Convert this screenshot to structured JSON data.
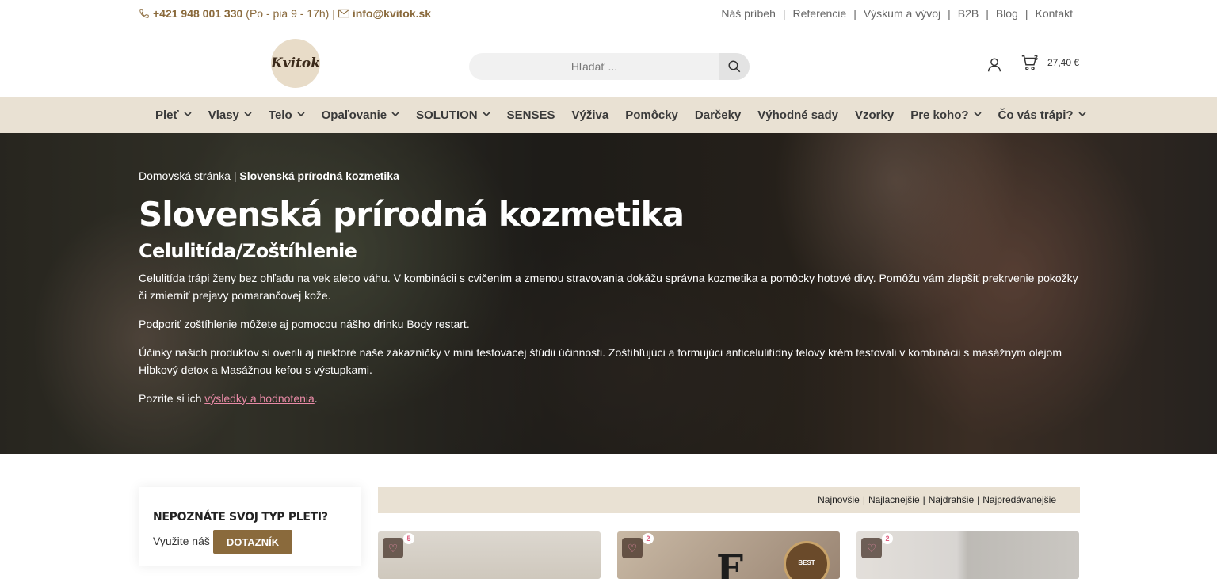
{
  "topbar": {
    "phone": "+421 948 001 330",
    "hours": "(Po - pia 9 - 17h) |",
    "email": "info@kvitok.sk",
    "links": [
      "Náš príbeh",
      "Referencie",
      "Výskum a vývoj",
      "B2B",
      "Blog",
      "Kontakt"
    ]
  },
  "header": {
    "logo_text": "Kvitok",
    "search_placeholder": "Hľadať ...",
    "cart_count": "3",
    "cart_total": "27,40 €"
  },
  "nav": {
    "items": [
      {
        "label": "Pleť",
        "dropdown": true
      },
      {
        "label": "Vlasy",
        "dropdown": true
      },
      {
        "label": "Telo",
        "dropdown": true
      },
      {
        "label": "Opaľovanie",
        "dropdown": true
      },
      {
        "label": "SOLUTION",
        "dropdown": true
      },
      {
        "label": "SENSES",
        "dropdown": false
      },
      {
        "label": "Výživa",
        "dropdown": false
      },
      {
        "label": "Pomôcky",
        "dropdown": false
      },
      {
        "label": "Darčeky",
        "dropdown": false
      },
      {
        "label": "Výhodné sady",
        "dropdown": false
      },
      {
        "label": "Vzorky",
        "dropdown": false
      },
      {
        "label": "Pre koho?",
        "dropdown": true
      },
      {
        "label": "Čo vás trápi?",
        "dropdown": true
      }
    ]
  },
  "hero": {
    "breadcrumb_home": "Domovská stránka",
    "breadcrumb_sep": " | ",
    "breadcrumb_current": "Slovenská prírodná kozmetika",
    "title": "Slovenská prírodná kozmetika",
    "subtitle": "Celulitída/Zoštíhlenie",
    "p1": "Celulitída trápi ženy bez ohľadu na vek alebo váhu. V kombinácii s cvičením a zmenou stravovania dokážu správna kozmetika a pomôcky hotové divy. Pomôžu vám zlepšiť prekrvenie pokožky či zmierniť prejavy pomarančovej kože.",
    "p2": "Podporiť zoštíhlenie môžete aj pomocou nášho drinku Body restart.",
    "p3": "Účinky našich produktov si overili aj niektoré naše zákazníčky v mini testovacej štúdii účinnosti. Zoštíhľujúci a formujúci anticelulitídny telový krém testovali v kombinácii s masážnym olejom Hĺbkový detox a Masážnou kefou s výstupkami.",
    "p4_prefix": "Pozrite si ich ",
    "p4_link": "výsledky a hodnotenia",
    "p4_suffix": "."
  },
  "sidebar": {
    "title": "NEPOZNÁTE SVOJ TYP PLETI?",
    "text": "Využite náš",
    "button": "DOTAZNÍK"
  },
  "sort": {
    "options": [
      "Najnovšie",
      "Najlacnejšie",
      "Najdrahšie",
      "Najpredávanejšie"
    ]
  },
  "products": [
    {
      "badge": "5"
    },
    {
      "badge": "2",
      "tag": "BEST"
    },
    {
      "badge": "2"
    }
  ],
  "colors": {
    "brand_brown": "#8a6a3c",
    "nav_bg": "#e9e1d3",
    "link_pink": "#e88aa6"
  }
}
